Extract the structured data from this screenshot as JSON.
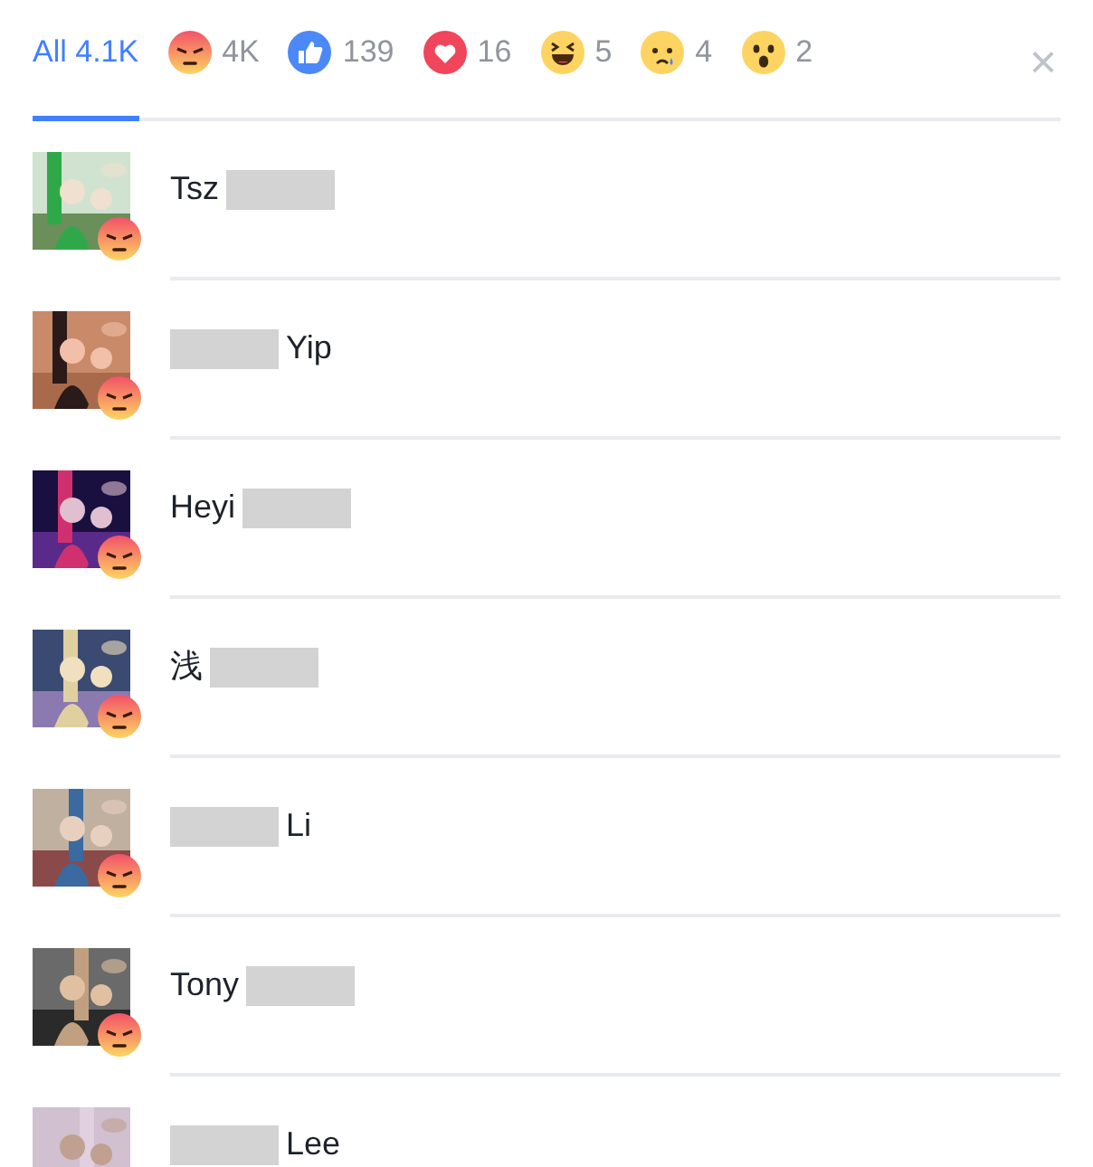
{
  "tabs": [
    {
      "kind": "all",
      "label": "All 4.1K",
      "selected": true
    },
    {
      "kind": "angry",
      "label": "4K",
      "selected": false
    },
    {
      "kind": "like",
      "label": "139",
      "selected": false
    },
    {
      "kind": "love",
      "label": "16",
      "selected": false
    },
    {
      "kind": "haha",
      "label": "5",
      "selected": false
    },
    {
      "kind": "sad",
      "label": "4",
      "selected": false
    },
    {
      "kind": "wow",
      "label": "2",
      "selected": false
    }
  ],
  "close": {
    "label": "×"
  },
  "people": [
    {
      "parts": [
        {
          "kind": "text",
          "text": "Tsz"
        },
        {
          "kind": "redacted"
        }
      ],
      "badge": {
        "kind": "angry"
      }
    },
    {
      "parts": [
        {
          "kind": "redacted"
        },
        {
          "kind": "text",
          "text": "Yip"
        }
      ],
      "badge": {
        "kind": "angry"
      }
    },
    {
      "parts": [
        {
          "kind": "text",
          "text": "Heyi"
        },
        {
          "kind": "redacted"
        }
      ],
      "badge": {
        "kind": "angry"
      }
    },
    {
      "parts": [
        {
          "kind": "text",
          "text": "浅"
        },
        {
          "kind": "redacted"
        }
      ],
      "badge": {
        "kind": "angry"
      }
    },
    {
      "parts": [
        {
          "kind": "redacted"
        },
        {
          "kind": "text",
          "text": "Li"
        }
      ],
      "badge": {
        "kind": "angry"
      }
    },
    {
      "parts": [
        {
          "kind": "text",
          "text": "Tony"
        },
        {
          "kind": "redacted"
        }
      ],
      "badge": {
        "kind": "angry"
      }
    },
    {
      "parts": [
        {
          "kind": "redacted"
        },
        {
          "kind": "text",
          "text": "Lee"
        }
      ]
    }
  ]
}
